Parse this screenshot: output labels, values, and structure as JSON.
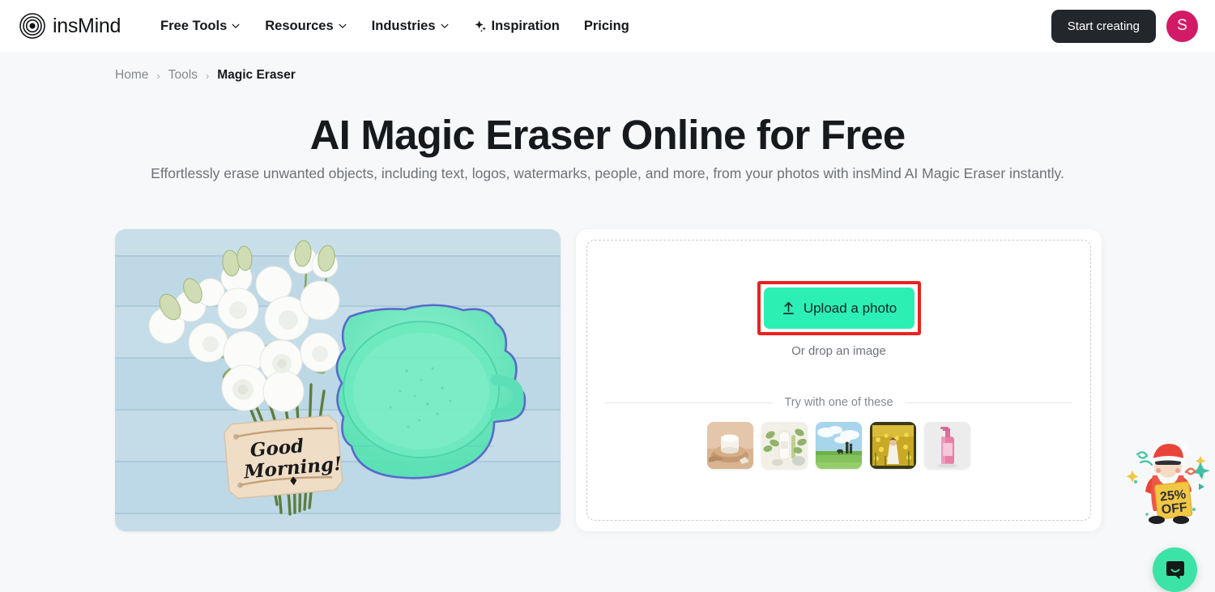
{
  "header": {
    "logo_text": "insMind",
    "logo_icon": "concentric-circles-logo",
    "nav": [
      {
        "label": "Free Tools",
        "icon": "chevron-down-icon",
        "has_chevron": true
      },
      {
        "label": "Resources",
        "icon": "chevron-down-icon",
        "has_chevron": true
      },
      {
        "label": "Industries",
        "icon": "chevron-down-icon",
        "has_chevron": true
      },
      {
        "label": "Inspiration",
        "icon": "sparkle-icon",
        "has_chevron": false
      },
      {
        "label": "Pricing",
        "icon": "",
        "has_chevron": false
      }
    ],
    "cta_label": "Start creating",
    "avatar_initial": "S",
    "avatar_color": "#d31a66",
    "cta_bg": "#23262b"
  },
  "breadcrumb": {
    "home": "Home",
    "tools": "Tools",
    "current": "Magic Eraser",
    "separator": "›"
  },
  "hero": {
    "title": "AI Magic Eraser Online for Free",
    "subtitle": "Effortlessly erase unwanted objects, including text, logos, watermarks, people, and more, from your photos with insMind AI Magic Eraser instantly."
  },
  "preview": {
    "alt": "White lisianthus flowers with a Good Morning gift tag on light blue wooden planks, coffee cup highlighted by a green selection mask",
    "tag_line1": "Good",
    "tag_line2": "Morning!",
    "selection_fill": "#3ce8a8",
    "selection_stroke": "#4a5bc8",
    "board_color": "#bcd9e6"
  },
  "uploader": {
    "button_label": "Upload a photo",
    "button_icon": "upload-arrow-icon",
    "button_color": "#2befb3",
    "highlight_color": "#e8231f",
    "drop_hint": "Or drop an image",
    "try_label": "Try with one of these",
    "samples": [
      {
        "name": "cosmetic-jar-on-wooden-podium"
      },
      {
        "name": "skincare-tube-with-eucalyptus"
      },
      {
        "name": "couple-and-dog-in-green-field"
      },
      {
        "name": "girl-in-sunflower-field"
      },
      {
        "name": "pink-pump-bottle"
      }
    ]
  },
  "widgets": {
    "promo_icon": "santa-promo-sticker",
    "promo_text_line1": "25%",
    "promo_text_line2": "OFF",
    "chat_icon": "chat-bubble-icon",
    "chat_color": "#3ce3a7"
  }
}
